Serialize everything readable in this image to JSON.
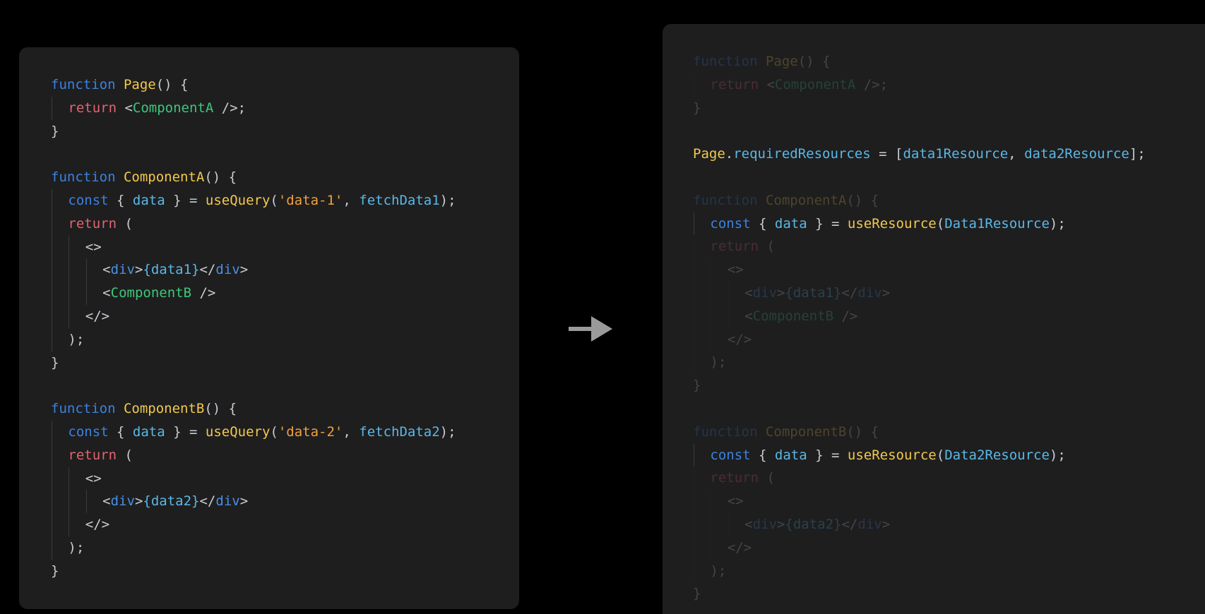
{
  "left_panel": {
    "lines": [
      {
        "indent": 0,
        "tokens": [
          {
            "t": "function ",
            "c": "kw"
          },
          {
            "t": "Page",
            "c": "fn"
          },
          {
            "t": "() {",
            "c": "pun"
          }
        ]
      },
      {
        "indent": 1,
        "tokens": [
          {
            "t": "return ",
            "c": "ret"
          },
          {
            "t": "<",
            "c": "pun"
          },
          {
            "t": "ComponentA",
            "c": "comp"
          },
          {
            "t": " />;",
            "c": "pun"
          }
        ]
      },
      {
        "indent": 0,
        "tokens": [
          {
            "t": "}",
            "c": "pun"
          }
        ]
      },
      {
        "indent": 0,
        "tokens": []
      },
      {
        "indent": 0,
        "tokens": [
          {
            "t": "function ",
            "c": "kw"
          },
          {
            "t": "ComponentA",
            "c": "fn"
          },
          {
            "t": "() {",
            "c": "pun"
          }
        ]
      },
      {
        "indent": 1,
        "tokens": [
          {
            "t": "const ",
            "c": "kw"
          },
          {
            "t": "{ ",
            "c": "pun"
          },
          {
            "t": "data",
            "c": "var"
          },
          {
            "t": " } = ",
            "c": "pun"
          },
          {
            "t": "useQuery",
            "c": "fn"
          },
          {
            "t": "(",
            "c": "pun"
          },
          {
            "t": "'data-1'",
            "c": "str"
          },
          {
            "t": ", ",
            "c": "pun"
          },
          {
            "t": "fetchData1",
            "c": "var"
          },
          {
            "t": ");",
            "c": "pun"
          }
        ]
      },
      {
        "indent": 1,
        "tokens": [
          {
            "t": "return ",
            "c": "ret"
          },
          {
            "t": "(",
            "c": "pun"
          }
        ]
      },
      {
        "indent": 2,
        "tokens": [
          {
            "t": "<>",
            "c": "pun"
          }
        ]
      },
      {
        "indent": 3,
        "tokens": [
          {
            "t": "<",
            "c": "pun"
          },
          {
            "t": "div",
            "c": "tag"
          },
          {
            "t": ">",
            "c": "pun"
          },
          {
            "t": "{data1}",
            "c": "var"
          },
          {
            "t": "</",
            "c": "pun"
          },
          {
            "t": "div",
            "c": "tag"
          },
          {
            "t": ">",
            "c": "pun"
          }
        ]
      },
      {
        "indent": 3,
        "tokens": [
          {
            "t": "<",
            "c": "pun"
          },
          {
            "t": "ComponentB",
            "c": "comp"
          },
          {
            "t": " />",
            "c": "pun"
          }
        ]
      },
      {
        "indent": 2,
        "tokens": [
          {
            "t": "</>",
            "c": "pun"
          }
        ]
      },
      {
        "indent": 1,
        "tokens": [
          {
            "t": ");",
            "c": "pun"
          }
        ]
      },
      {
        "indent": 0,
        "tokens": [
          {
            "t": "}",
            "c": "pun"
          }
        ]
      },
      {
        "indent": 0,
        "tokens": []
      },
      {
        "indent": 0,
        "tokens": [
          {
            "t": "function ",
            "c": "kw"
          },
          {
            "t": "ComponentB",
            "c": "fn"
          },
          {
            "t": "() {",
            "c": "pun"
          }
        ]
      },
      {
        "indent": 1,
        "tokens": [
          {
            "t": "const ",
            "c": "kw"
          },
          {
            "t": "{ ",
            "c": "pun"
          },
          {
            "t": "data",
            "c": "var"
          },
          {
            "t": " } = ",
            "c": "pun"
          },
          {
            "t": "useQuery",
            "c": "fn"
          },
          {
            "t": "(",
            "c": "pun"
          },
          {
            "t": "'data-2'",
            "c": "str"
          },
          {
            "t": ", ",
            "c": "pun"
          },
          {
            "t": "fetchData2",
            "c": "var"
          },
          {
            "t": ");",
            "c": "pun"
          }
        ]
      },
      {
        "indent": 1,
        "tokens": [
          {
            "t": "return ",
            "c": "ret"
          },
          {
            "t": "(",
            "c": "pun"
          }
        ]
      },
      {
        "indent": 2,
        "tokens": [
          {
            "t": "<>",
            "c": "pun"
          }
        ]
      },
      {
        "indent": 3,
        "tokens": [
          {
            "t": "<",
            "c": "pun"
          },
          {
            "t": "div",
            "c": "tag"
          },
          {
            "t": ">",
            "c": "pun"
          },
          {
            "t": "{data2}",
            "c": "var"
          },
          {
            "t": "</",
            "c": "pun"
          },
          {
            "t": "div",
            "c": "tag"
          },
          {
            "t": ">",
            "c": "pun"
          }
        ]
      },
      {
        "indent": 2,
        "tokens": [
          {
            "t": "</>",
            "c": "pun"
          }
        ]
      },
      {
        "indent": 1,
        "tokens": [
          {
            "t": ");",
            "c": "pun"
          }
        ]
      },
      {
        "indent": 0,
        "tokens": [
          {
            "t": "}",
            "c": "pun"
          }
        ]
      }
    ]
  },
  "arrow": {
    "icon": "arrow-right-icon",
    "color": "#9a9a9a"
  },
  "right_panel": {
    "lines": [
      {
        "indent": 0,
        "dim": true,
        "tokens": [
          {
            "t": "function ",
            "c": "kw"
          },
          {
            "t": "Page",
            "c": "fn"
          },
          {
            "t": "() {",
            "c": "pun"
          }
        ]
      },
      {
        "indent": 1,
        "dim": true,
        "tokens": [
          {
            "t": "return ",
            "c": "ret"
          },
          {
            "t": "<",
            "c": "pun"
          },
          {
            "t": "ComponentA",
            "c": "comp"
          },
          {
            "t": " />;",
            "c": "pun"
          }
        ]
      },
      {
        "indent": 0,
        "dim": true,
        "tokens": [
          {
            "t": "}",
            "c": "pun"
          }
        ]
      },
      {
        "indent": 0,
        "dim": false,
        "tokens": []
      },
      {
        "indent": 0,
        "dim": false,
        "tokens": [
          {
            "t": "Page",
            "c": "fn"
          },
          {
            "t": ".",
            "c": "pun"
          },
          {
            "t": "requiredResources",
            "c": "var"
          },
          {
            "t": " = [",
            "c": "pun"
          },
          {
            "t": "data1Resource",
            "c": "var"
          },
          {
            "t": ", ",
            "c": "pun"
          },
          {
            "t": "data2Resource",
            "c": "var"
          },
          {
            "t": "];",
            "c": "pun"
          }
        ]
      },
      {
        "indent": 0,
        "dim": false,
        "tokens": []
      },
      {
        "indent": 0,
        "dim": true,
        "tokens": [
          {
            "t": "function ",
            "c": "kw"
          },
          {
            "t": "ComponentA",
            "c": "fn"
          },
          {
            "t": "() {",
            "c": "pun"
          }
        ]
      },
      {
        "indent": 1,
        "dim": false,
        "tokens": [
          {
            "t": "const ",
            "c": "kw"
          },
          {
            "t": "{ ",
            "c": "pun"
          },
          {
            "t": "data",
            "c": "var"
          },
          {
            "t": " } = ",
            "c": "pun"
          },
          {
            "t": "useResource",
            "c": "fn"
          },
          {
            "t": "(",
            "c": "pun"
          },
          {
            "t": "Data1Resource",
            "c": "var"
          },
          {
            "t": ");",
            "c": "pun"
          }
        ]
      },
      {
        "indent": 1,
        "dim": true,
        "tokens": [
          {
            "t": "return ",
            "c": "ret"
          },
          {
            "t": "(",
            "c": "pun"
          }
        ]
      },
      {
        "indent": 2,
        "dim": true,
        "tokens": [
          {
            "t": "<>",
            "c": "pun"
          }
        ]
      },
      {
        "indent": 3,
        "dim": true,
        "tokens": [
          {
            "t": "<",
            "c": "pun"
          },
          {
            "t": "div",
            "c": "tag"
          },
          {
            "t": ">",
            "c": "pun"
          },
          {
            "t": "{data1}",
            "c": "var"
          },
          {
            "t": "</",
            "c": "pun"
          },
          {
            "t": "div",
            "c": "tag"
          },
          {
            "t": ">",
            "c": "pun"
          }
        ]
      },
      {
        "indent": 3,
        "dim": true,
        "tokens": [
          {
            "t": "<",
            "c": "pun"
          },
          {
            "t": "ComponentB",
            "c": "comp"
          },
          {
            "t": " />",
            "c": "pun"
          }
        ]
      },
      {
        "indent": 2,
        "dim": true,
        "tokens": [
          {
            "t": "</>",
            "c": "pun"
          }
        ]
      },
      {
        "indent": 1,
        "dim": true,
        "tokens": [
          {
            "t": ");",
            "c": "pun"
          }
        ]
      },
      {
        "indent": 0,
        "dim": true,
        "tokens": [
          {
            "t": "}",
            "c": "pun"
          }
        ]
      },
      {
        "indent": 0,
        "dim": false,
        "tokens": []
      },
      {
        "indent": 0,
        "dim": true,
        "tokens": [
          {
            "t": "function ",
            "c": "kw"
          },
          {
            "t": "ComponentB",
            "c": "fn"
          },
          {
            "t": "() {",
            "c": "pun"
          }
        ]
      },
      {
        "indent": 1,
        "dim": false,
        "tokens": [
          {
            "t": "const ",
            "c": "kw"
          },
          {
            "t": "{ ",
            "c": "pun"
          },
          {
            "t": "data",
            "c": "var"
          },
          {
            "t": " } = ",
            "c": "pun"
          },
          {
            "t": "useResource",
            "c": "fn"
          },
          {
            "t": "(",
            "c": "pun"
          },
          {
            "t": "Data2Resource",
            "c": "var"
          },
          {
            "t": ");",
            "c": "pun"
          }
        ]
      },
      {
        "indent": 1,
        "dim": true,
        "tokens": [
          {
            "t": "return ",
            "c": "ret"
          },
          {
            "t": "(",
            "c": "pun"
          }
        ]
      },
      {
        "indent": 2,
        "dim": true,
        "tokens": [
          {
            "t": "<>",
            "c": "pun"
          }
        ]
      },
      {
        "indent": 3,
        "dim": true,
        "tokens": [
          {
            "t": "<",
            "c": "pun"
          },
          {
            "t": "div",
            "c": "tag"
          },
          {
            "t": ">",
            "c": "pun"
          },
          {
            "t": "{data2}",
            "c": "var"
          },
          {
            "t": "</",
            "c": "pun"
          },
          {
            "t": "div",
            "c": "tag"
          },
          {
            "t": ">",
            "c": "pun"
          }
        ]
      },
      {
        "indent": 2,
        "dim": true,
        "tokens": [
          {
            "t": "</>",
            "c": "pun"
          }
        ]
      },
      {
        "indent": 1,
        "dim": true,
        "tokens": [
          {
            "t": ");",
            "c": "pun"
          }
        ]
      },
      {
        "indent": 0,
        "dim": true,
        "tokens": [
          {
            "t": "}",
            "c": "pun"
          }
        ]
      }
    ]
  }
}
